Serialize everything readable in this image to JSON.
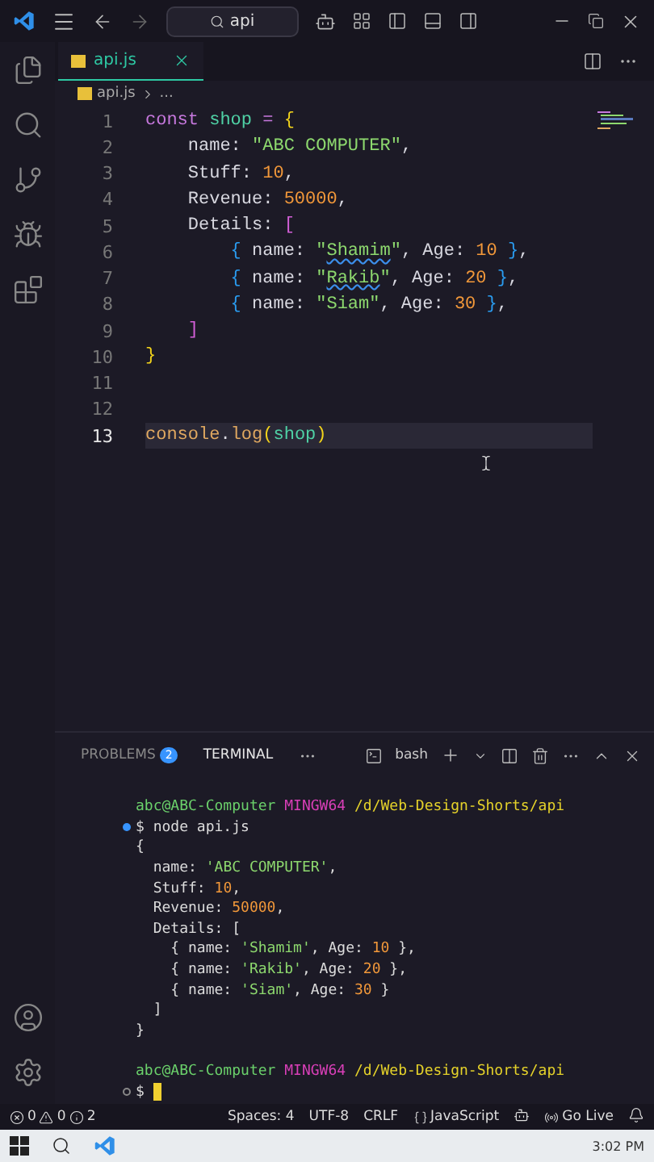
{
  "title_bar": {
    "search": {
      "value": "api"
    }
  },
  "tabs": [
    {
      "label": "api.js",
      "selected": true
    }
  ],
  "breadcrumb": {
    "file": "api.js",
    "rest": "..."
  },
  "editor": {
    "lines": [
      {
        "number": "1",
        "current": false,
        "tokens": [
          {
            "kind": "kw",
            "t": "const "
          },
          {
            "kind": "var",
            "t": "shop "
          },
          {
            "kind": "op",
            "t": "= "
          },
          {
            "kind": "b1",
            "t": "{"
          }
        ]
      },
      {
        "number": "2",
        "current": false,
        "tokens": [
          {
            "kind": "prop",
            "t": "    name: "
          },
          {
            "kind": "str",
            "t": "\"ABC COMPUTER\""
          },
          {
            "kind": "prop",
            "t": ","
          }
        ]
      },
      {
        "number": "3",
        "current": false,
        "tokens": [
          {
            "kind": "prop",
            "t": "    Stuff: "
          },
          {
            "kind": "num",
            "t": "10"
          },
          {
            "kind": "prop",
            "t": ","
          }
        ]
      },
      {
        "number": "4",
        "current": false,
        "tokens": [
          {
            "kind": "prop",
            "t": "    Revenue: "
          },
          {
            "kind": "num",
            "t": "50000"
          },
          {
            "kind": "prop",
            "t": ","
          }
        ]
      },
      {
        "number": "5",
        "current": false,
        "tokens": [
          {
            "kind": "prop",
            "t": "    Details: "
          },
          {
            "kind": "b2",
            "t": "["
          }
        ]
      },
      {
        "number": "6",
        "current": false,
        "tokens": [
          {
            "kind": "b3",
            "t": "        { "
          },
          {
            "kind": "prop",
            "t": "name: "
          },
          {
            "kind": "str",
            "t": "\""
          },
          {
            "kind": "str",
            "t": "Shamim",
            "squiggle": true
          },
          {
            "kind": "str",
            "t": "\""
          },
          {
            "kind": "prop",
            "t": ", Age: "
          },
          {
            "kind": "num",
            "t": "10 "
          },
          {
            "kind": "b3",
            "t": "}"
          },
          {
            "kind": "prop",
            "t": ","
          }
        ]
      },
      {
        "number": "7",
        "current": false,
        "tokens": [
          {
            "kind": "b3",
            "t": "        { "
          },
          {
            "kind": "prop",
            "t": "name: "
          },
          {
            "kind": "str",
            "t": "\""
          },
          {
            "kind": "str",
            "t": "Rakib",
            "squiggle": true
          },
          {
            "kind": "str",
            "t": "\""
          },
          {
            "kind": "prop",
            "t": ", Age: "
          },
          {
            "kind": "num",
            "t": "20 "
          },
          {
            "kind": "b3",
            "t": "}"
          },
          {
            "kind": "prop",
            "t": ","
          }
        ]
      },
      {
        "number": "8",
        "current": false,
        "tokens": [
          {
            "kind": "b3",
            "t": "        { "
          },
          {
            "kind": "prop",
            "t": "name: "
          },
          {
            "kind": "str",
            "t": "\"Siam\""
          },
          {
            "kind": "prop",
            "t": ", Age: "
          },
          {
            "kind": "num",
            "t": "30 "
          },
          {
            "kind": "b3",
            "t": "}"
          },
          {
            "kind": "prop",
            "t": ","
          }
        ]
      },
      {
        "number": "9",
        "current": false,
        "tokens": [
          {
            "kind": "b2",
            "t": "    ]"
          }
        ]
      },
      {
        "number": "10",
        "current": false,
        "tokens": [
          {
            "kind": "b1",
            "t": "}"
          }
        ]
      },
      {
        "number": "11",
        "current": false
      },
      {
        "number": "12",
        "current": false
      },
      {
        "number": "13",
        "current": true,
        "tokens": [
          {
            "kind": "fn",
            "t": "console"
          },
          {
            "kind": "prop",
            "t": "."
          },
          {
            "kind": "fn",
            "t": "log"
          },
          {
            "kind": "b1",
            "t": "("
          },
          {
            "kind": "var",
            "t": "shop"
          },
          {
            "kind": "b1",
            "t": ")"
          }
        ]
      }
    ]
  },
  "panel": {
    "tabs": [
      {
        "label": "PROBLEMS",
        "badge": "2",
        "selected": false
      },
      {
        "label": "TERMINAL",
        "selected": true
      }
    ],
    "shell": "bash",
    "cursor": true,
    "lines": [
      {
        "kind": "output",
        "tokens": [
          {
            "kind": "user",
            "t": "abc@ABC-Computer "
          },
          {
            "kind": "host",
            "t": "MINGW64 "
          },
          {
            "kind": "path",
            "t": "/d/Web-Design-Shorts/api"
          }
        ]
      },
      {
        "kind": "done",
        "tokens": [
          {
            "kind": "plain",
            "t": "$ node api.js"
          }
        ]
      },
      {
        "kind": "output",
        "tokens": [
          {
            "kind": "plain",
            "t": "{"
          }
        ]
      },
      {
        "kind": "output",
        "tokens": [
          {
            "kind": "plain",
            "t": "  name: "
          },
          {
            "kind": "str",
            "t": "'ABC COMPUTER'"
          },
          {
            "kind": "plain",
            "t": ","
          }
        ]
      },
      {
        "kind": "output",
        "tokens": [
          {
            "kind": "plain",
            "t": "  Stuff: "
          },
          {
            "kind": "num",
            "t": "10"
          },
          {
            "kind": "plain",
            "t": ","
          }
        ]
      },
      {
        "kind": "output",
        "tokens": [
          {
            "kind": "plain",
            "t": "  Revenue: "
          },
          {
            "kind": "num",
            "t": "50000"
          },
          {
            "kind": "plain",
            "t": ","
          }
        ]
      },
      {
        "kind": "output",
        "tokens": [
          {
            "kind": "plain",
            "t": "  Details: ["
          }
        ]
      },
      {
        "kind": "output",
        "tokens": [
          {
            "kind": "plain",
            "t": "    { name: "
          },
          {
            "kind": "str",
            "t": "'Shamim'"
          },
          {
            "kind": "plain",
            "t": ", Age: "
          },
          {
            "kind": "num",
            "t": "10"
          },
          {
            "kind": "plain",
            "t": " },"
          }
        ]
      },
      {
        "kind": "output",
        "tokens": [
          {
            "kind": "plain",
            "t": "    { name: "
          },
          {
            "kind": "str",
            "t": "'Rakib'"
          },
          {
            "kind": "plain",
            "t": ", Age: "
          },
          {
            "kind": "num",
            "t": "20"
          },
          {
            "kind": "plain",
            "t": " },"
          }
        ]
      },
      {
        "kind": "output",
        "tokens": [
          {
            "kind": "plain",
            "t": "    { name: "
          },
          {
            "kind": "str",
            "t": "'Siam'"
          },
          {
            "kind": "plain",
            "t": ", Age: "
          },
          {
            "kind": "num",
            "t": "30"
          },
          {
            "kind": "plain",
            "t": " }"
          }
        ]
      },
      {
        "kind": "output",
        "tokens": [
          {
            "kind": "plain",
            "t": "  ]"
          }
        ]
      },
      {
        "kind": "output",
        "tokens": [
          {
            "kind": "plain",
            "t": "}"
          }
        ]
      },
      {
        "kind": "blank"
      },
      {
        "kind": "output",
        "tokens": [
          {
            "kind": "user",
            "t": "abc@ABC-Computer "
          },
          {
            "kind": "host",
            "t": "MINGW64 "
          },
          {
            "kind": "path",
            "t": "/d/Web-Design-Shorts/api"
          }
        ]
      },
      {
        "kind": "idle",
        "tokens": [
          {
            "kind": "plain",
            "t": "$ "
          }
        ]
      }
    ]
  },
  "status_bar": {
    "errors": "0",
    "warnings": "0",
    "infos": "2",
    "items": [
      {
        "kind": "text",
        "label": "Spaces: 4"
      },
      {
        "kind": "text",
        "label": "UTF-8"
      },
      {
        "kind": "text",
        "label": "CRLF"
      },
      {
        "kind": "language",
        "label": "JavaScript"
      },
      {
        "kind": "copilot"
      },
      {
        "kind": "live",
        "label": "Go Live"
      },
      {
        "kind": "bell"
      }
    ]
  },
  "taskbar": {
    "time": "3:02 PM"
  }
}
